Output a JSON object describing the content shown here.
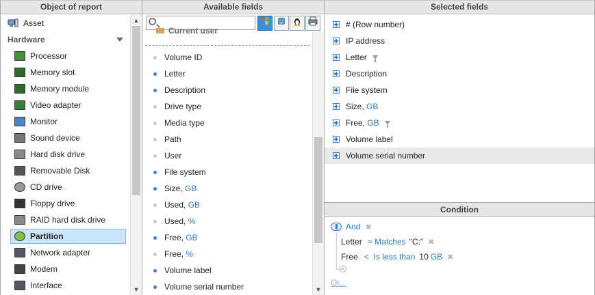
{
  "left": {
    "header": "Object of report",
    "top_item": "Asset",
    "group": "Hardware",
    "items": [
      {
        "label": "Processor",
        "icon": "processor-icon"
      },
      {
        "label": "Memory slot",
        "icon": "memory-slot-icon"
      },
      {
        "label": "Memory module",
        "icon": "memory-module-icon"
      },
      {
        "label": "Video adapter",
        "icon": "video-adapter-icon"
      },
      {
        "label": "Monitor",
        "icon": "monitor-icon"
      },
      {
        "label": "Sound device",
        "icon": "speaker-icon"
      },
      {
        "label": "Hard disk drive",
        "icon": "hdd-icon"
      },
      {
        "label": "Removable Disk",
        "icon": "usb-icon"
      },
      {
        "label": "CD drive",
        "icon": "cd-icon"
      },
      {
        "label": "Floppy drive",
        "icon": "floppy-icon"
      },
      {
        "label": "RAID hard disk drive",
        "icon": "raid-icon"
      },
      {
        "label": "Partition",
        "icon": "partition-icon",
        "selected": true
      },
      {
        "label": "Network adapter",
        "icon": "network-icon"
      },
      {
        "label": "Modem",
        "icon": "modem-icon"
      },
      {
        "label": "Interface",
        "icon": "interface-icon"
      }
    ]
  },
  "middle": {
    "header": "Available fields",
    "cut_item": "Current user",
    "fields": [
      {
        "label": "Volume ID",
        "unit": "",
        "blue": false
      },
      {
        "label": "Letter",
        "unit": "",
        "blue": true
      },
      {
        "label": "Description",
        "unit": "",
        "blue": true
      },
      {
        "label": "Drive type",
        "unit": "",
        "blue": false
      },
      {
        "label": "Media type",
        "unit": "",
        "blue": false
      },
      {
        "label": "Path",
        "unit": "",
        "blue": false
      },
      {
        "label": "User",
        "unit": "",
        "blue": false
      },
      {
        "label": "File system",
        "unit": "",
        "blue": true
      },
      {
        "label": "Size, ",
        "unit": "GB",
        "blue": true
      },
      {
        "label": "Used, ",
        "unit": "GB",
        "blue": false
      },
      {
        "label": "Used, ",
        "unit": "%",
        "blue": false
      },
      {
        "label": "Free, ",
        "unit": "GB",
        "blue": true
      },
      {
        "label": "Free, ",
        "unit": "%",
        "blue": false
      },
      {
        "label": "Volume label",
        "unit": "",
        "blue": true
      },
      {
        "label": "Volume serial number",
        "unit": "",
        "blue": true
      }
    ]
  },
  "right": {
    "header": "Selected fields",
    "fields": [
      {
        "label": "# (Row number)",
        "unit": "",
        "filter": false
      },
      {
        "label": "IP address",
        "unit": "",
        "filter": false
      },
      {
        "label": "Letter",
        "unit": "",
        "filter": true
      },
      {
        "label": "Description",
        "unit": "",
        "filter": false
      },
      {
        "label": "File system",
        "unit": "",
        "filter": false
      },
      {
        "label": "Size, ",
        "unit": "GB",
        "filter": false
      },
      {
        "label": "Free, ",
        "unit": "GB",
        "filter": true
      },
      {
        "label": "Volume label",
        "unit": "",
        "filter": false
      },
      {
        "label": "Volume serial number",
        "unit": "",
        "filter": false,
        "highlighted": true
      }
    ]
  },
  "condition": {
    "header": "Condition",
    "op": "And",
    "c1": {
      "field": "Letter",
      "sym": "≈",
      "op": "Matches",
      "value": "\"C:\""
    },
    "c2": {
      "field": "Free",
      "sym": "<",
      "op": "Is less than",
      "value": "10",
      "unit": "GB"
    },
    "or": "Or..."
  }
}
